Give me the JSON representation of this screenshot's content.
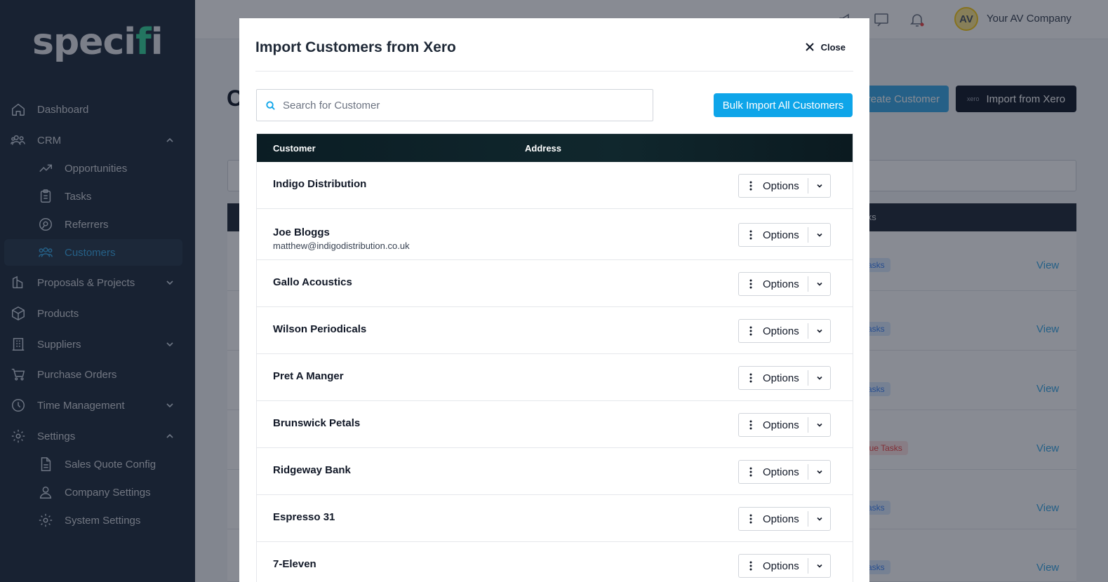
{
  "sidebar": {
    "logo": "specifi",
    "items": [
      {
        "label": "Dashboard",
        "icon": "home-icon"
      },
      {
        "label": "CRM",
        "icon": "users-icon"
      },
      {
        "label": "Opportunities",
        "icon": "trend-icon"
      },
      {
        "label": "Tasks",
        "icon": "clipboard-icon"
      },
      {
        "label": "Referrers",
        "icon": "referrer-icon"
      },
      {
        "label": "Customers",
        "icon": "customers-icon"
      },
      {
        "label": "Proposals & Projects",
        "icon": "proposals-icon"
      },
      {
        "label": "Products",
        "icon": "box-icon"
      },
      {
        "label": "Suppliers",
        "icon": "building-icon"
      },
      {
        "label": "Purchase Orders",
        "icon": "cart-icon"
      },
      {
        "label": "Time Management",
        "icon": "clock-icon"
      },
      {
        "label": "Settings",
        "icon": "gear-icon"
      },
      {
        "label": "Sales Quote Config",
        "icon": "document-icon"
      },
      {
        "label": "Company Settings",
        "icon": "company-icon"
      },
      {
        "label": "System Settings",
        "icon": "gear-icon"
      }
    ],
    "active_color": "#38a8e6"
  },
  "header": {
    "avatar_initials": "AV",
    "company_name": "Your AV Company"
  },
  "background_page": {
    "title": "C",
    "create_button": "Create Customer",
    "import_button": "Import from Xero",
    "xero_logo_text": "xero",
    "table_header": "asks",
    "rows": [
      {
        "badge": "Tasks",
        "view": "View"
      },
      {
        "badge": "Tasks",
        "view": "View"
      },
      {
        "badge": "Tasks",
        "view": "View"
      },
      {
        "badge": "Due Tasks",
        "view": "View"
      },
      {
        "badge": "Tasks",
        "view": "View"
      },
      {
        "badge": "Tasks",
        "view": "View"
      }
    ]
  },
  "modal": {
    "title": "Import Customers from Xero",
    "close_label": "Close",
    "search_placeholder": "Search for Customer",
    "bulk_button": "Bulk Import All Customers",
    "columns": {
      "customer": "Customer",
      "address": "Address"
    },
    "option_label": "Options",
    "customers": [
      {
        "name": "Indigo Distribution",
        "email": ""
      },
      {
        "name": "Joe Bloggs",
        "email": "matthew@indigodistribution.co.uk"
      },
      {
        "name": "Gallo Acoustics",
        "email": ""
      },
      {
        "name": "Wilson Periodicals",
        "email": ""
      },
      {
        "name": "Pret A Manger",
        "email": ""
      },
      {
        "name": "Brunswick Petals",
        "email": ""
      },
      {
        "name": "Ridgeway Bank",
        "email": ""
      },
      {
        "name": "Espresso 31",
        "email": ""
      },
      {
        "name": "7-Eleven",
        "email": ""
      }
    ]
  }
}
